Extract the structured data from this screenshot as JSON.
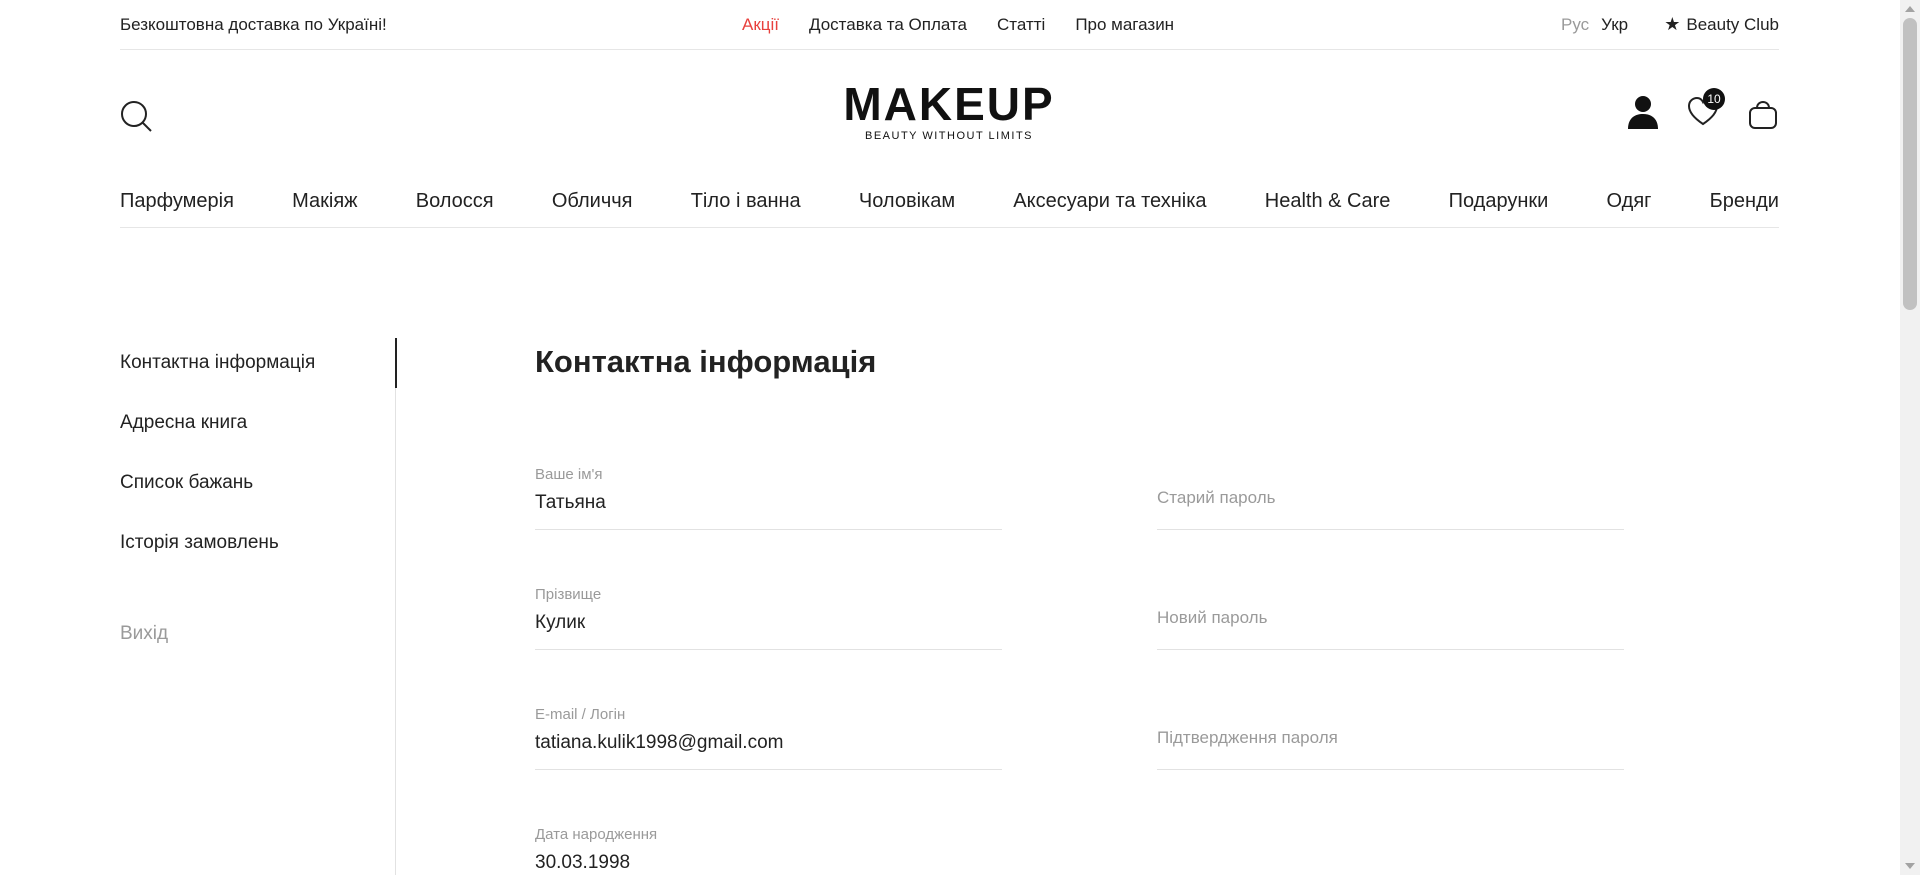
{
  "topbar": {
    "free_shipping": "Безкоштовна доставка по Україні!",
    "links": [
      {
        "label": "Акції",
        "accent": true
      },
      {
        "label": "Доставка та Оплата",
        "accent": false
      },
      {
        "label": "Статті",
        "accent": false
      },
      {
        "label": "Про магазин",
        "accent": false
      }
    ],
    "lang_ru": "Рус",
    "lang_uk": "Укр",
    "club_label": "Beauty Club"
  },
  "header": {
    "logo_word": "MAKEUP",
    "logo_tagline": "BEAUTY WITHOUT LIMITS",
    "wishlist_count": "10"
  },
  "nav": [
    "Парфумерія",
    "Макіяж",
    "Волосся",
    "Обличчя",
    "Тіло і ванна",
    "Чоловікам",
    "Аксесуари та техніка",
    "Health & Care",
    "Подарунки",
    "Одяг",
    "Бренди"
  ],
  "sidebar": {
    "items": [
      "Контактна інформація",
      "Адресна книга",
      "Список бажань",
      "Історія замовлень"
    ],
    "logout": "Вихід"
  },
  "main": {
    "title": "Контактна інформація",
    "left_fields": [
      {
        "label": "Ваше ім'я",
        "value": "Татьяна"
      },
      {
        "label": "Прізвище",
        "value": "Кулик"
      },
      {
        "label": "E-mail / Логін",
        "value": "tatiana.kulik1998@gmail.com"
      },
      {
        "label": "Дата народження",
        "value": "30.03.1998"
      }
    ],
    "right_fields": [
      {
        "placeholder": "Старий пароль"
      },
      {
        "placeholder": "Новий пароль"
      },
      {
        "placeholder": "Підтвердження пароля"
      }
    ]
  },
  "colors": {
    "accent": "#e8413d",
    "text": "#222222",
    "muted": "#9a9a9a"
  }
}
